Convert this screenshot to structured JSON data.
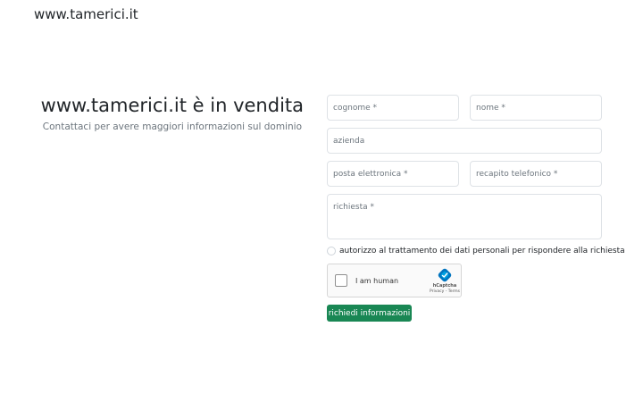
{
  "site_title": "www.tamerici.it",
  "hero": {
    "title": "www.tamerici.it è in vendita",
    "subtitle": "Contattaci per avere maggiori informazioni sul dominio"
  },
  "form": {
    "cognome_placeholder": "cognome *",
    "nome_placeholder": "nome *",
    "azienda_placeholder": "azienda",
    "email_placeholder": "posta elettronica *",
    "phone_placeholder": "recapito telefonico *",
    "richiesta_placeholder": "richiesta *",
    "consent_label": "autorizzo al trattamento dei dati personali per rispondere alla richiesta",
    "submit_label": "richiedi informazioni"
  },
  "captcha": {
    "label": "I am human",
    "brand": "hCaptcha",
    "links": "Privacy - Terms",
    "logo_icon": "hcaptcha-logo-icon"
  },
  "colors": {
    "accent": "#198754",
    "muted_text": "#6c757d",
    "border": "#dee2e6"
  }
}
